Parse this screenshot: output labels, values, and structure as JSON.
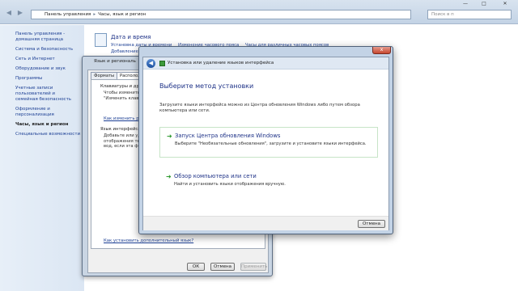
{
  "explorer": {
    "breadcrumb": [
      "Панель управления",
      "Часы, язык и регион"
    ],
    "search_placeholder": "Поиск в п",
    "sidebar": {
      "items": [
        {
          "label": "Панель управления - домашняя страница"
        },
        {
          "label": "Система и безопасность"
        },
        {
          "label": "Сеть и Интернет"
        },
        {
          "label": "Оборудование и звук"
        },
        {
          "label": "Программы"
        },
        {
          "label": "Учетные записи пользователей и семейная безопасность"
        },
        {
          "label": "Оформление и персонализация"
        },
        {
          "label": "Часы, язык и регион"
        },
        {
          "label": "Специальные возможности"
        }
      ]
    },
    "section": {
      "title": "Дата и время",
      "links": [
        "Установка даты и времени",
        "Изменение часового пояса",
        "Часы для различных часовых поясов"
      ],
      "sub": "Добавление"
    }
  },
  "region_dialog": {
    "title": "Язык и региональ",
    "tabs": [
      "Форматы",
      "Расположе"
    ],
    "keyboards_group": "Клавиатуры и друг",
    "keyboards_text": "Чтобы изменить кл\n\"Изменить клавиатур",
    "change_link": "Как изменить раскл",
    "display_lang_group": "Язык интерфейса",
    "display_lang_text": "Добавьте или уд\nотображения тек\nвод, если эта фу",
    "bottom_link": "Как установить дополнительный язык?",
    "buttons": {
      "ok": "ОК",
      "cancel": "Отмена",
      "apply": "Применить"
    }
  },
  "wizard": {
    "window_title": "Установка или удаление языков интерфейса",
    "heading": "Выберите метод установки",
    "description": "Загрузите языки интерфейса можно из Центра обновления Windows либо путем обзора компьютера или сети.",
    "options": [
      {
        "title": "Запуск Центра обновления Windows",
        "subtitle": "Выберите \"Необязательные обновления\", загрузите и установите языки интерфейса."
      },
      {
        "title": "Обзор компьютера или сети",
        "subtitle": "Найти и установить языки отображения вручную."
      }
    ],
    "cancel_label": "Отмена",
    "close_glyph": "x"
  }
}
